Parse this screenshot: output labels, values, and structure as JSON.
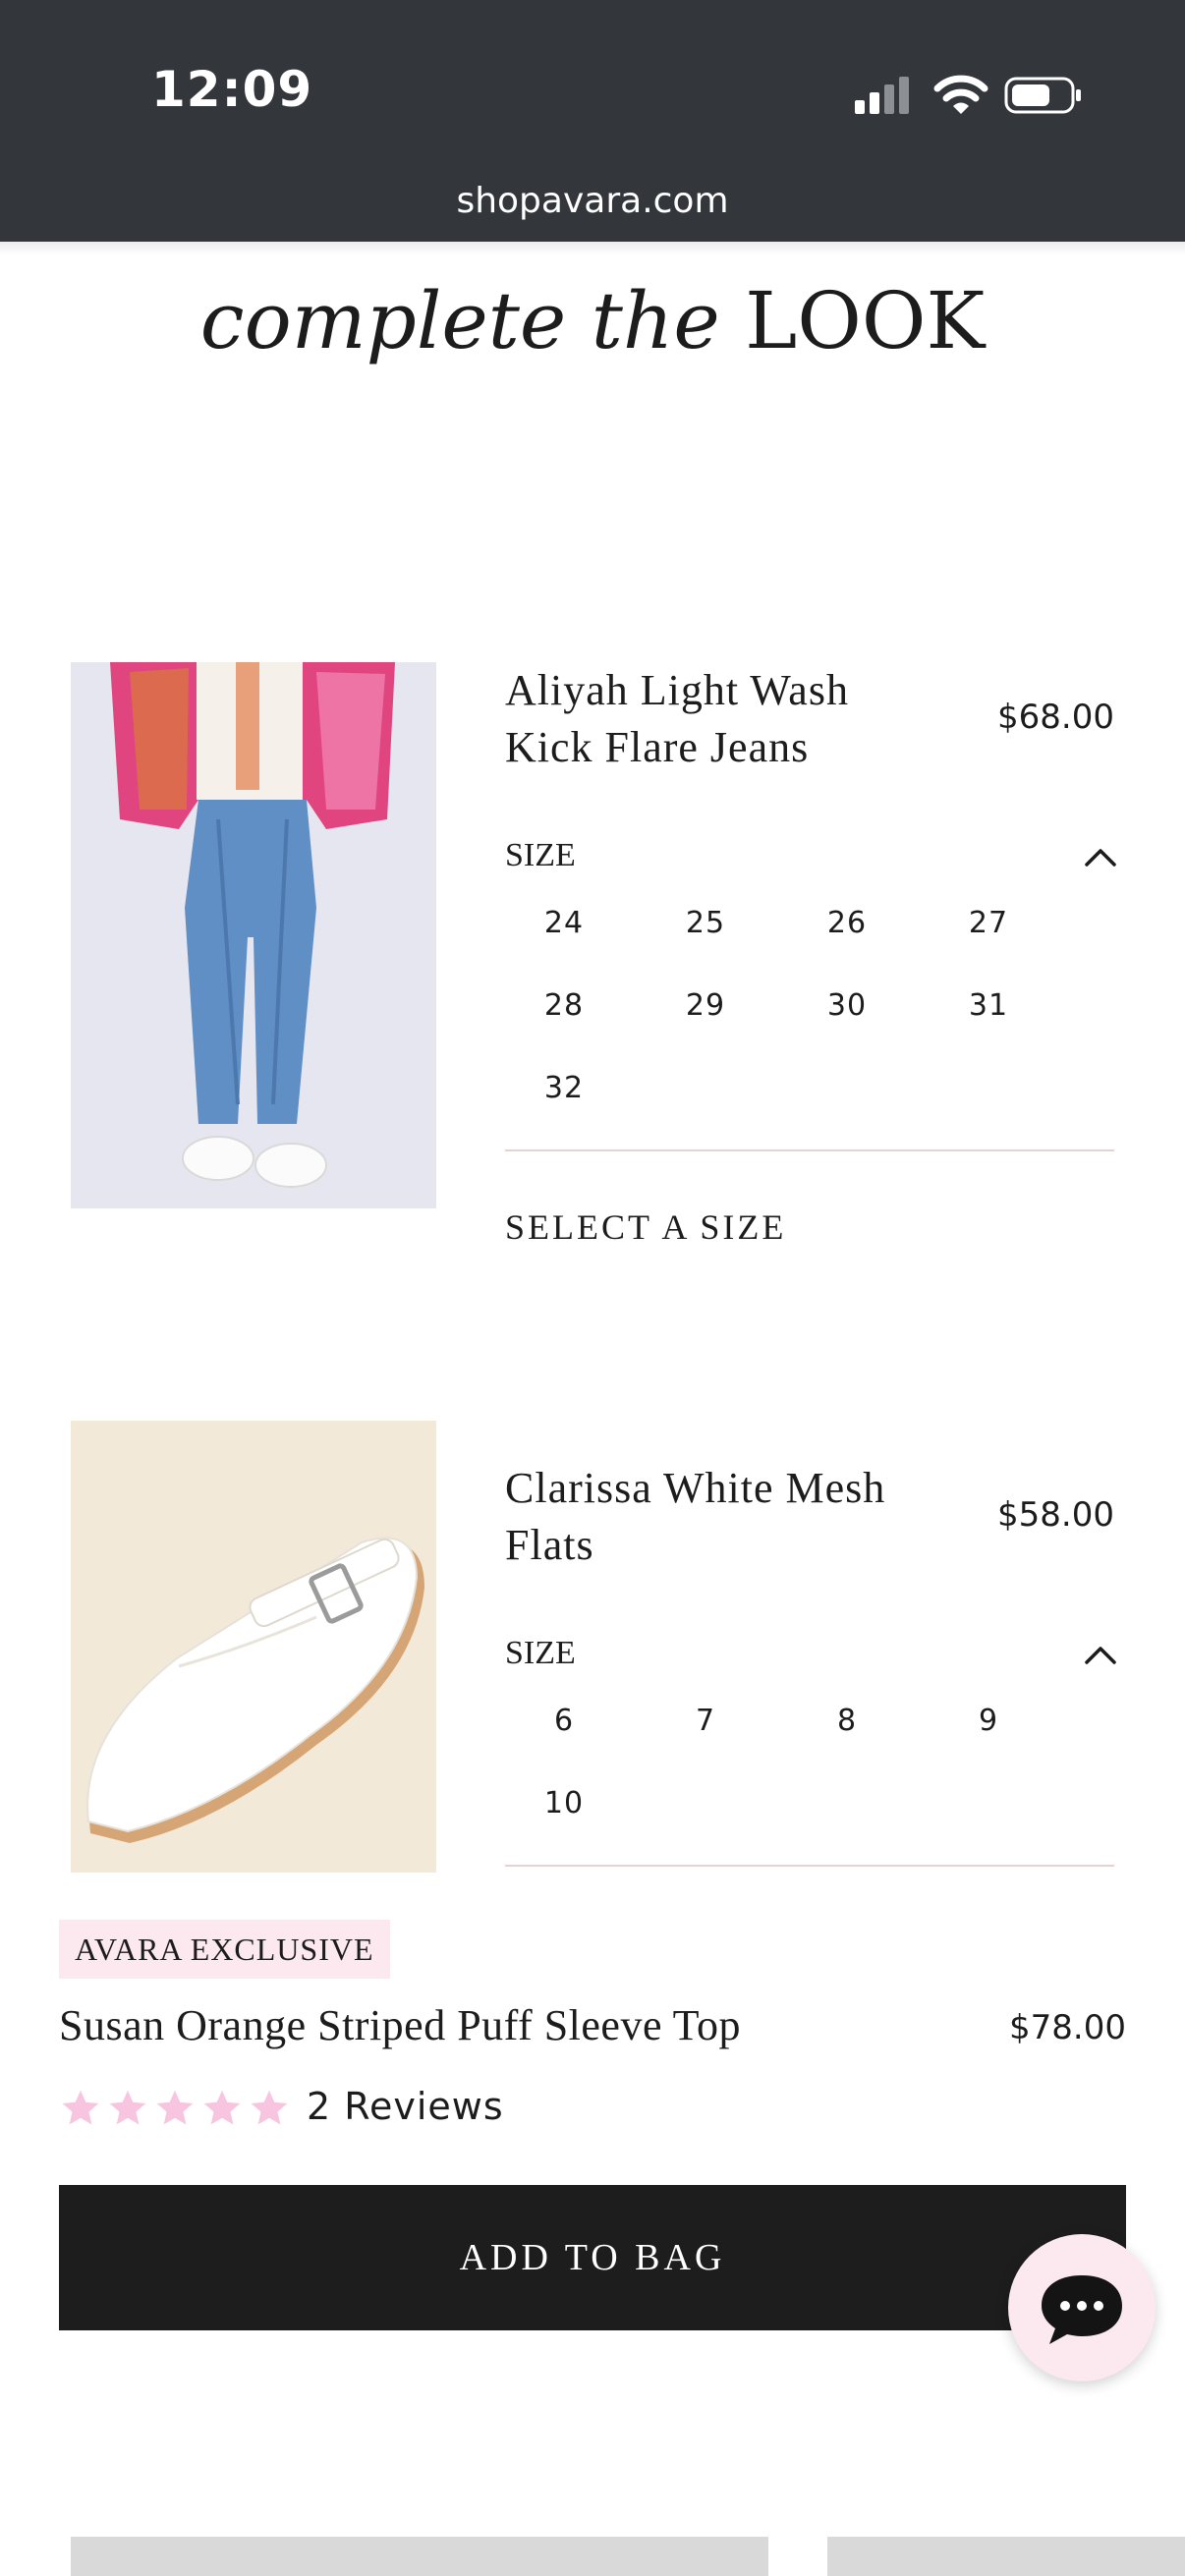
{
  "status_bar": {
    "time": "12:09",
    "url": "shopavara.com"
  },
  "section": {
    "title_italic": "complete the",
    "title_caps": "LOOK"
  },
  "products": [
    {
      "name": "Aliyah Light Wash Kick Flare Jeans",
      "price": "$68.00",
      "size_label": "SIZE",
      "sizes": [
        "24",
        "25",
        "26",
        "27",
        "28",
        "29",
        "30",
        "31",
        "32"
      ],
      "select_label": "SELECT A SIZE"
    },
    {
      "name": "Clarissa White Mesh Flats",
      "price": "$58.00",
      "size_label": "SIZE",
      "sizes": [
        "6",
        "7",
        "8",
        "9",
        "10"
      ]
    }
  ],
  "main_product": {
    "badge": "AVARA EXCLUSIVE",
    "name": "Susan Orange Striped Puff Sleeve Top",
    "price": "$78.00",
    "rating": 5,
    "reviews": "2 Reviews",
    "add_to_bag": "ADD TO BAG"
  },
  "colors": {
    "status_bar": "#33363b",
    "button": "#1d1d1d",
    "badge_bg": "#fce8ef",
    "star": "#f7c5e0",
    "divider": "#e6d3cf"
  },
  "icons": [
    "signal-icon",
    "wifi-icon",
    "battery-icon",
    "chevron-up-icon",
    "star-icon",
    "chat-icon"
  ]
}
